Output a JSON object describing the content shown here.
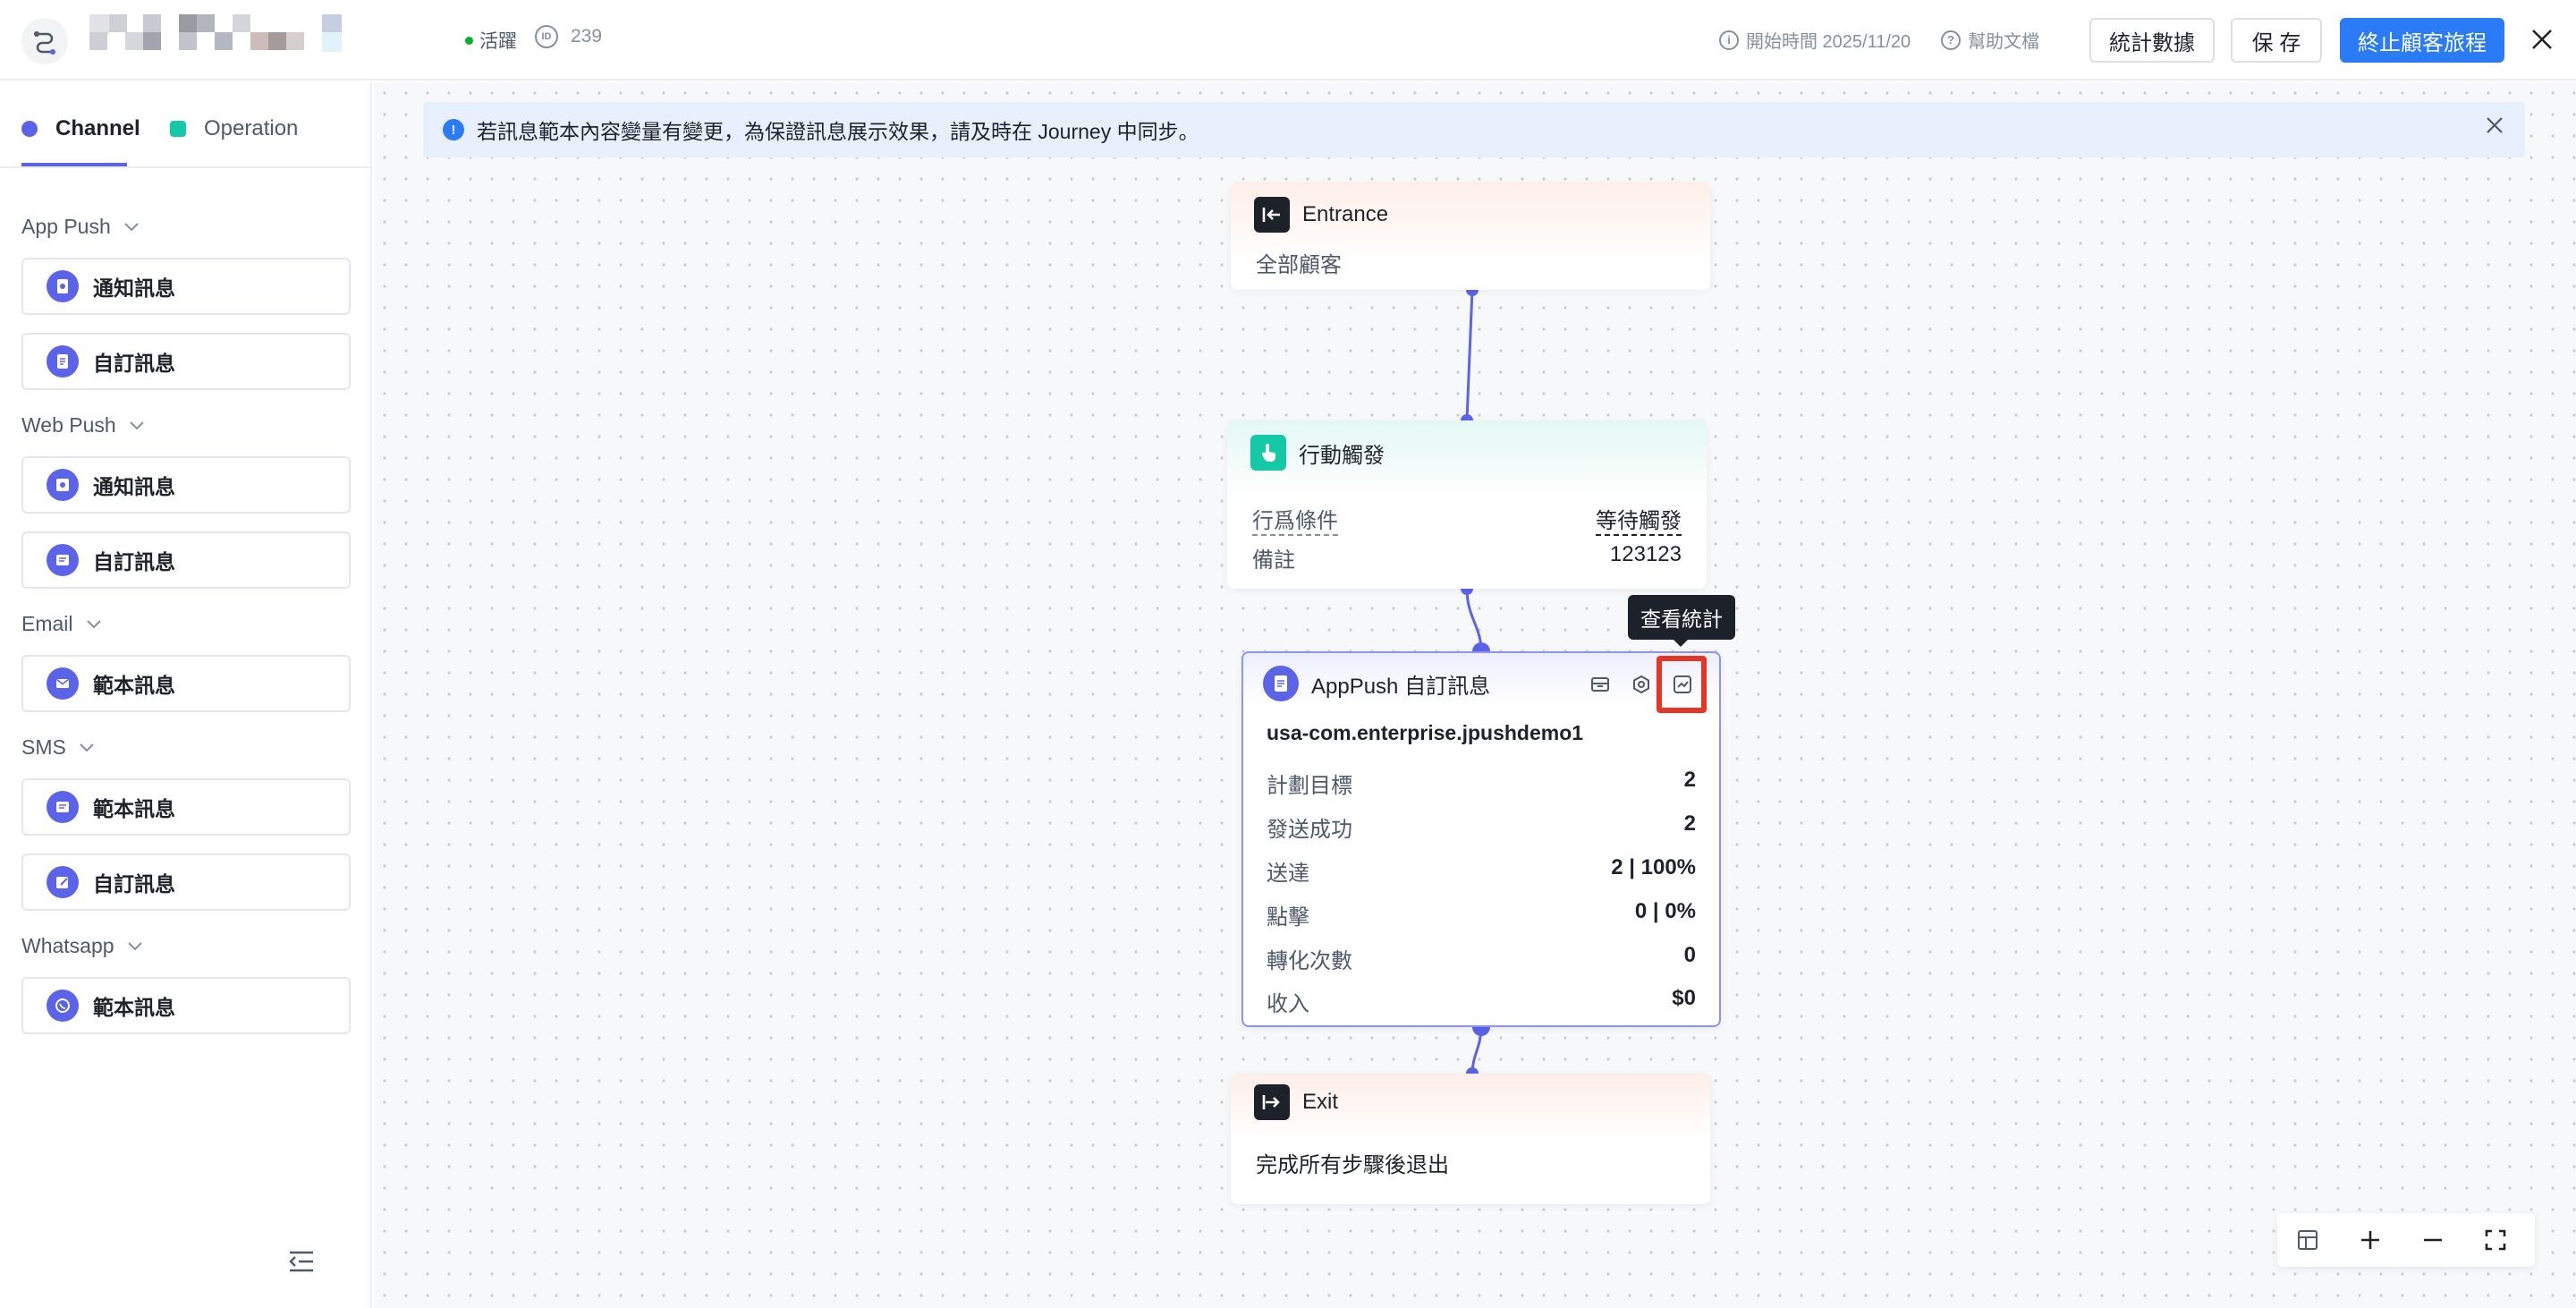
{
  "header": {
    "status": "活躍",
    "id_value": "239",
    "start_time": "開始時間 2025/11/20",
    "help": "幫助文檔",
    "stats_button": "統計數據",
    "save_button": "保 存",
    "stop_button": "終止顧客旅程",
    "colors": {
      "primary": "#2b7bf6",
      "active": "#00b42a"
    }
  },
  "sidebar": {
    "tabs": [
      {
        "label": "Channel",
        "color": "#5b63e8",
        "active": true
      },
      {
        "label": "Operation",
        "color": "#14c9a5",
        "active": false
      }
    ],
    "groups": [
      {
        "title": "App Push",
        "items": [
          {
            "label": "通知訊息",
            "icon": "bell-icon"
          },
          {
            "label": "自訂訊息",
            "icon": "document-icon"
          }
        ]
      },
      {
        "title": "Web Push",
        "items": [
          {
            "label": "通知訊息",
            "icon": "bell-icon"
          },
          {
            "label": "自訂訊息",
            "icon": "message-icon"
          }
        ]
      },
      {
        "title": "Email",
        "items": [
          {
            "label": "範本訊息",
            "icon": "mail-icon"
          }
        ]
      },
      {
        "title": "SMS",
        "items": [
          {
            "label": "範本訊息",
            "icon": "message-icon"
          },
          {
            "label": "自訂訊息",
            "icon": "edit-icon"
          }
        ]
      },
      {
        "title": "Whatsapp",
        "items": [
          {
            "label": "範本訊息",
            "icon": "whatsapp-icon"
          }
        ]
      }
    ]
  },
  "notice": {
    "text": "若訊息範本內容變量有變更，為保證訊息展示效果，請及時在 Journey 中同步。"
  },
  "nodes": {
    "entrance": {
      "title": "Entrance",
      "body": "全部顧客"
    },
    "trigger": {
      "title": "行動觸發",
      "condition_label": "行爲條件",
      "condition_value": "等待觸發",
      "note_label": "備註",
      "note_value": "123123"
    },
    "apppush": {
      "title": "AppPush 自訂訊息",
      "app": "usa-com.enterprise.jpushdemo1",
      "rows": [
        {
          "label": "計劃目標",
          "value": "2"
        },
        {
          "label": "發送成功",
          "value": "2"
        },
        {
          "label": "送達",
          "value": "2 | 100%"
        },
        {
          "label": "點擊",
          "value": "0 | 0%"
        },
        {
          "label": "轉化次數",
          "value": "0"
        },
        {
          "label": "收入",
          "value": "$0"
        }
      ],
      "tooltip": "查看統計"
    },
    "exit": {
      "title": "Exit",
      "body": "完成所有步驟後退出"
    }
  }
}
